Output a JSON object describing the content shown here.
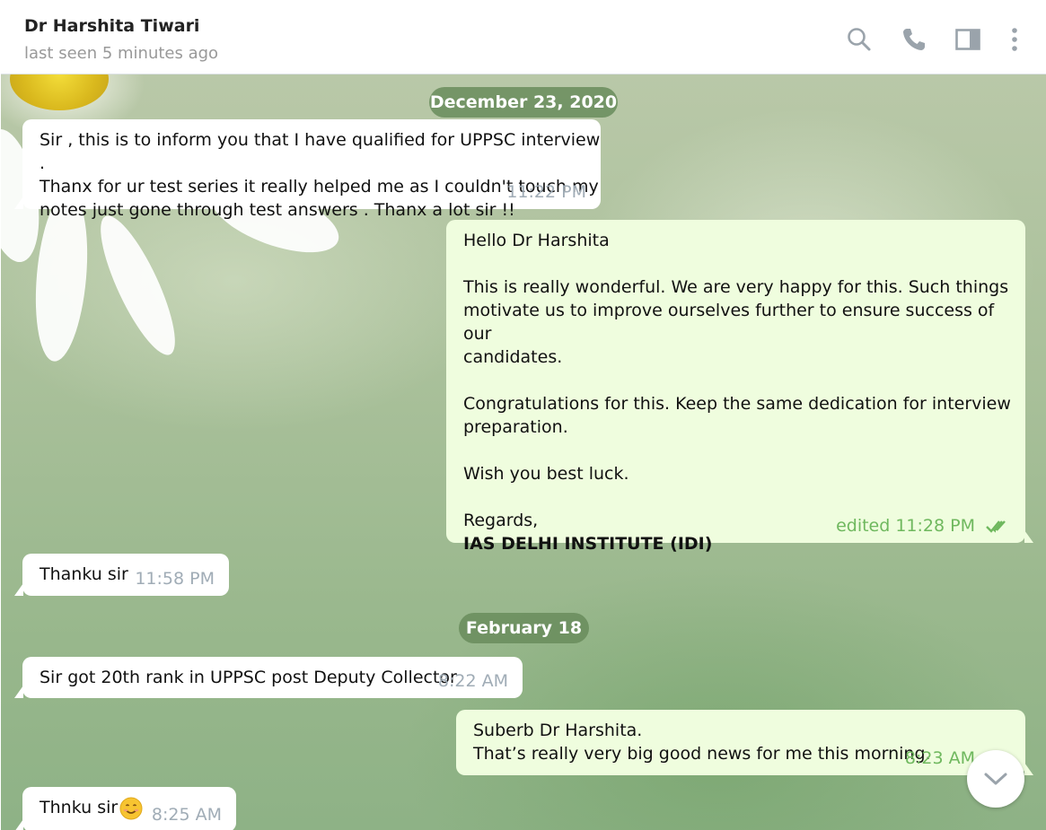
{
  "header": {
    "title": "Dr Harshita Tiwari",
    "status": "last seen 5 minutes ago",
    "icons": [
      "search-icon",
      "phone-icon",
      "sidebar-toggle-icon",
      "more-vert-icon"
    ]
  },
  "dates": [
    "December 23, 2020",
    "February 18"
  ],
  "messages": [
    {
      "direction": "incoming",
      "text": "Sir , this is to inform you that I have qualified for UPPSC interview .\nThanx for ur test series it really helped me as I couldn't touch my\nnotes just gone through test answers . Thanx a lot sir !!",
      "time": "11:22 PM"
    },
    {
      "direction": "outgoing",
      "text": "Hello Dr Harshita\n\nThis is really wonderful. We are very happy for this. Such things\nmotivate us to improve ourselves further to ensure success of our\ncandidates.\n\nCongratulations for this. Keep the same dedication for interview\npreparation.\n\nWish you best luck.\n\nRegards,",
      "signature": "IAS DELHI INSTITUTE (IDI)",
      "time": "edited 11:28 PM",
      "read": true
    },
    {
      "direction": "incoming",
      "text": "Thanku sir",
      "time": "11:58 PM"
    },
    {
      "direction": "incoming",
      "text": "Sir got 20th rank in UPPSC post Deputy Collector",
      "time": "8:22 AM"
    },
    {
      "direction": "outgoing",
      "text": "Suberb Dr Harshita.\nThat’s really very big good news for me this morning.",
      "time": "8:23 AM",
      "read": true
    },
    {
      "direction": "incoming",
      "text": "Thnku sir",
      "emoji": "smiling-face-emoji",
      "time": "8:25 AM"
    }
  ],
  "colors": {
    "incoming_bubble": "#ffffff",
    "outgoing_bubble": "#effdde",
    "outgoing_meta": "#6fb85e",
    "date_pill": "#698c5c"
  }
}
